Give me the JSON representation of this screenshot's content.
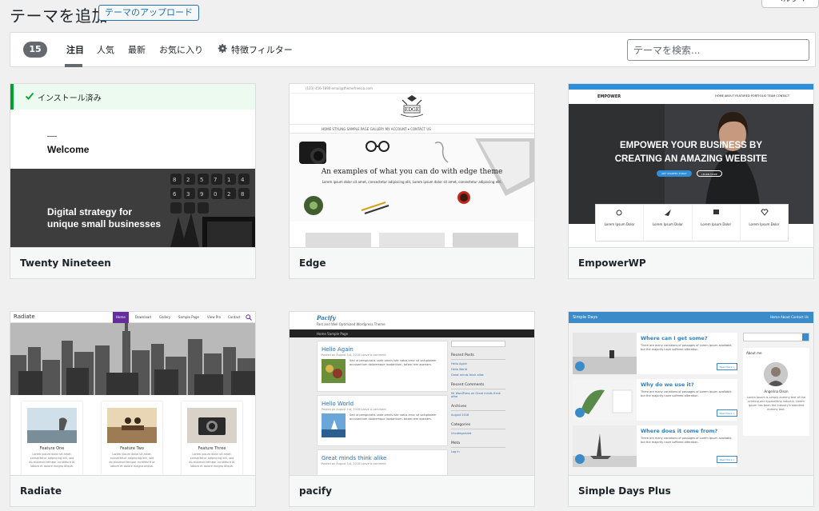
{
  "header": {
    "title": "テーマを追加",
    "upload_button": "テーマのアップロード",
    "help_button": "ヘルプ ▾"
  },
  "filter": {
    "count": "15",
    "tabs": [
      {
        "label": "注目",
        "active": true
      },
      {
        "label": "人気",
        "active": false
      },
      {
        "label": "最新",
        "active": false
      },
      {
        "label": "お気に入り",
        "active": false
      }
    ],
    "feature_filter": "特徴フィルター",
    "search_placeholder": "テーマを検索..."
  },
  "themes": [
    {
      "name": "Twenty Nineteen",
      "installed": true,
      "installed_label": "インストール済み",
      "preview": {
        "heading": "Welcome",
        "hero_line1": "Digital strategy for",
        "hero_line2": "unique small businesses"
      }
    },
    {
      "name": "Edge",
      "preview": {
        "logo": "EDGE",
        "top_info": "(123) 456-7890  email@themefreesia.com",
        "nav": "HOME   STYLING   SAMPLE PAGE   GALLERY   MY ACCOUNT ▾   CONTACT US",
        "tagline": "An examples of what you can do with edge theme",
        "subline": "Lorem ipsum dolor sit amet, consectetur adipiscing elit. Lorem ipsum dolor sit amet, consectetur adipiscing elit."
      }
    },
    {
      "name": "EmpowerWP",
      "preview": {
        "logo": "EMPOWER",
        "nav": "HOME   ABOUT   FEATURED   PORTFOLIO   TEAM   CONTACT",
        "hero_line1": "EMPOWER YOUR BUSINESS BY",
        "hero_line2": "CREATING AN AMAZING WEBSITE",
        "btn1": "GET STARTED TODAY",
        "btn2": "LEARN MORE",
        "box_label": "Lorem Ipsum Dolor"
      }
    },
    {
      "name": "Radiate",
      "preview": {
        "logo": "Radiate",
        "nav": [
          "Home",
          "Download",
          "Gallery",
          "Sample Page",
          "View Pro",
          "Contact"
        ],
        "features": [
          "Feature One",
          "Feature Two",
          "Feature Three"
        ],
        "feature_text": "Lorem ipsum dolor sit amet, consectetur adipiscing elit, sed do eiusmod tempor incididunt ut labore et dolore magna aliqua."
      }
    },
    {
      "name": "pacify",
      "preview": {
        "logo": "Pacify",
        "tagline": "Fast and Well Optimized Wordpress Theme",
        "nav": "Home   Sample Page",
        "posts": [
          "Hello Again",
          "Hello World",
          "Great minds think alike"
        ],
        "post_meta": "Posted on August 1st, 2018   Leave a comment",
        "post_text": "Sed ut perspiciatis unde omnis iste natus error sit voluptatem accusantium doloremque laudantium, totam rem aperiam.",
        "sidebar": {
          "recent_posts": "Recent Posts",
          "recent_posts_items": [
            "Hello Again",
            "Hello World",
            "Great minds think alike"
          ],
          "recent_comments": "Recent Comments",
          "recent_comments_item": "Mr WordPress on Great minds think alike",
          "archives": "Archives",
          "archives_item": "August 2018",
          "categories": "Categories",
          "categories_item": "Uncategorized",
          "meta": "Meta",
          "meta_item": "Log in"
        }
      }
    },
    {
      "name": "Simple Days Plus",
      "preview": {
        "logo": "Simple Days",
        "nav": "Home   About   Contact Us",
        "posts": [
          "Where can I get some?",
          "Why do we use it?",
          "Where does it come from?"
        ],
        "post_text": "There are many variations of passages of Lorem Ipsum available, but the majority have suffered alteration.",
        "read_more": "Read More »",
        "about_title": "About me",
        "author": "Angelina Olson",
        "bio": "Lorem Ipsum is simply dummy text of the printing and typesetting industry. Lorem Ipsum has been the industry's standard dummy text."
      }
    }
  ],
  "colors": {
    "accent": "#2271b1",
    "installed_green": "#00a32a",
    "edge_bg": "#fafafa",
    "empower_blue": "#2f8ed8",
    "radiate_purple": "#632e9b",
    "simple_days_blue": "#3c8bc9"
  }
}
